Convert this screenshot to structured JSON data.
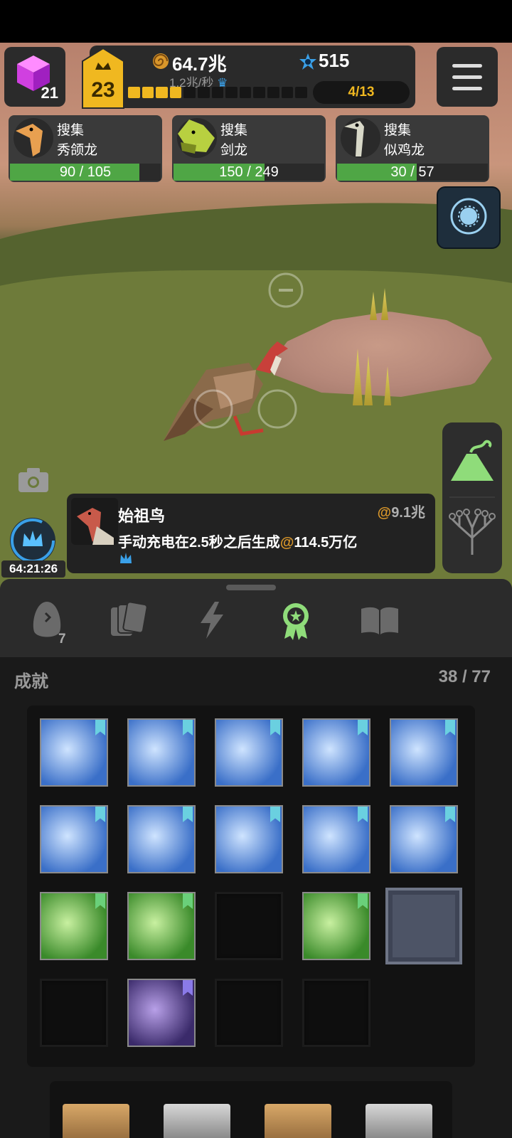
{
  "hud": {
    "cube_count": "21",
    "level": "23",
    "amber_value": "64.7兆",
    "amber_rate": "1.2兆/秒",
    "dna_value": "515",
    "xp_segments_total": 13,
    "xp_segments_filled": 4,
    "stage_progress": "4/13"
  },
  "collect_cards": [
    {
      "action": "搜集",
      "dino": "秀颌龙",
      "progress": "90 / 105",
      "fill": 0.857
    },
    {
      "action": "搜集",
      "dino": "剑龙",
      "progress": "150 / 249",
      "fill": 0.602
    },
    {
      "action": "搜集",
      "dino": "似鸡龙",
      "progress": "30 / 57",
      "fill": 0.526
    }
  ],
  "timer": "64:21:26",
  "info_card": {
    "name": "始祖鸟",
    "price": "9.1兆",
    "desc_prefix": "手动充电在",
    "desc_time": "2.5秒",
    "desc_mid": "之后生成",
    "desc_amount": "114.5万亿"
  },
  "tabs": [
    "egg-icon",
    "cards-icon",
    "lightning-icon",
    "achievement-medal-icon",
    "book-icon"
  ],
  "egg_count": "7",
  "achievements": {
    "title": "成就",
    "count": "38 / 77",
    "tiles": [
      {
        "state": "unlocked",
        "theme": "blue-dna"
      },
      {
        "state": "unlocked",
        "theme": "blue-jellyfish"
      },
      {
        "state": "unlocked",
        "theme": "blue-fish"
      },
      {
        "state": "unlocked",
        "theme": "blue-rock"
      },
      {
        "state": "unlocked",
        "theme": "blue-humans"
      },
      {
        "state": "unlocked",
        "theme": "blue-face"
      },
      {
        "state": "unlocked",
        "theme": "blue-face-2"
      },
      {
        "state": "unlocked",
        "theme": "blue-skull"
      },
      {
        "state": "unlocked",
        "theme": "blue-whale"
      },
      {
        "state": "unlocked",
        "theme": "blue-lion"
      },
      {
        "state": "unlocked",
        "theme": "green-skull"
      },
      {
        "state": "unlocked",
        "theme": "green-light"
      },
      {
        "state": "locked",
        "theme": ""
      },
      {
        "state": "unlocked",
        "theme": "green-skull-2"
      },
      {
        "state": "selected",
        "theme": ""
      },
      {
        "state": "locked",
        "theme": ""
      },
      {
        "state": "unlocked",
        "theme": "purple-sphere"
      },
      {
        "state": "locked",
        "theme": ""
      },
      {
        "state": "locked",
        "theme": ""
      }
    ]
  },
  "colors": {
    "gold": "#f0b820",
    "progress_green": "#4fa645",
    "achievement_green": "#8fdc7a",
    "dna_blue": "#3aa0e8"
  }
}
